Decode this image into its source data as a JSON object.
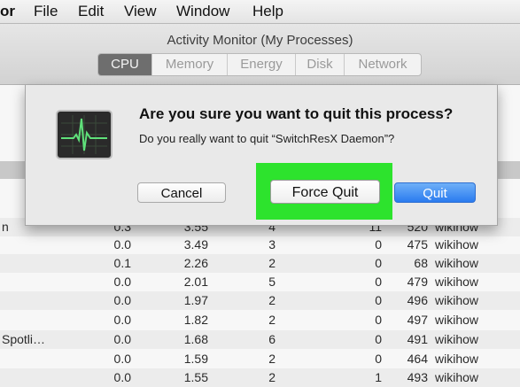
{
  "menubar": {
    "app_fragment": "or",
    "items": [
      "File",
      "Edit",
      "View",
      "Window",
      "Help"
    ]
  },
  "window": {
    "title": "Activity Monitor (My Processes)",
    "tabs": [
      {
        "label": "CPU",
        "active": true
      },
      {
        "label": "Memory",
        "active": false
      },
      {
        "label": "Energy",
        "active": false
      },
      {
        "label": "Disk",
        "active": false
      },
      {
        "label": "Network",
        "active": false
      }
    ]
  },
  "dialog": {
    "title": "Are you sure you want to quit this process?",
    "message": "Do you really want to quit “SwitchResX Daemon”?",
    "cancel_label": "Cancel",
    "force_quit_label": "Force Quit",
    "quit_label": "Quit",
    "highlight_color": "#2de32d",
    "primary_color": "#2a7bef",
    "icon": "activity-monitor-icon"
  },
  "table": {
    "rows": [
      {
        "name": "n",
        "cpu": "0.3",
        "time": "3.55",
        "threads": "4",
        "wakeups": "11",
        "pid": "520",
        "user": "wikihow"
      },
      {
        "name": "",
        "cpu": "0.0",
        "time": "3.49",
        "threads": "3",
        "wakeups": "0",
        "pid": "475",
        "user": "wikihow"
      },
      {
        "name": "",
        "cpu": "0.1",
        "time": "2.26",
        "threads": "2",
        "wakeups": "0",
        "pid": "68",
        "user": "wikihow"
      },
      {
        "name": "",
        "cpu": "0.0",
        "time": "2.01",
        "threads": "5",
        "wakeups": "0",
        "pid": "479",
        "user": "wikihow"
      },
      {
        "name": "",
        "cpu": "0.0",
        "time": "1.97",
        "threads": "2",
        "wakeups": "0",
        "pid": "496",
        "user": "wikihow"
      },
      {
        "name": "",
        "cpu": "0.0",
        "time": "1.82",
        "threads": "2",
        "wakeups": "0",
        "pid": "497",
        "user": "wikihow"
      },
      {
        "name": "Spotli…",
        "cpu": "0.0",
        "time": "1.68",
        "threads": "6",
        "wakeups": "0",
        "pid": "491",
        "user": "wikihow"
      },
      {
        "name": "",
        "cpu": "0.0",
        "time": "1.59",
        "threads": "2",
        "wakeups": "0",
        "pid": "464",
        "user": "wikihow"
      },
      {
        "name": "",
        "cpu": "0.0",
        "time": "1.55",
        "threads": "2",
        "wakeups": "1",
        "pid": "493",
        "user": "wikihow"
      }
    ]
  }
}
